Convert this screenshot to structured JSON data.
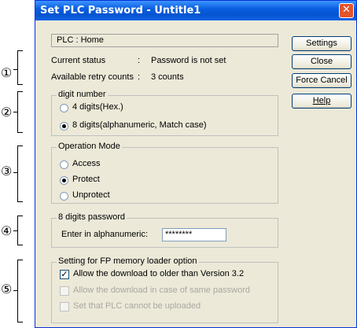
{
  "window": {
    "title": "Set PLC Password - Untitle1",
    "close_glyph": "✕"
  },
  "plc_bar": "PLC  :  Home",
  "status": {
    "current_label": "Current status",
    "current_sep": ":",
    "current_value": "Password is not set",
    "retry_label": "Available retry counts",
    "retry_sep": ":",
    "retry_value": "3 counts"
  },
  "buttons": {
    "settings": "Settings",
    "close": "Close",
    "force_cancel": "Force Cancel",
    "help": "Help"
  },
  "digit_group": {
    "title": "digit number",
    "opt1": "4 digits(Hex.)",
    "opt2": "8 digits(alphanumeric, Match case)",
    "selected": 2
  },
  "mode_group": {
    "title": "Operation Mode",
    "opt1": "Access",
    "opt2": "Protect",
    "opt3": "Unprotect",
    "selected": 2
  },
  "password_group": {
    "title": "8 digits password",
    "label": "Enter in alphanumeric:",
    "value": "********"
  },
  "loader_group": {
    "title": "Setting for FP memory loader option",
    "opt1": "Allow the download to older than Version 3.2",
    "opt2": "Allow the download in case of same password",
    "opt3": "Set that PLC cannot be uploaded",
    "check_glyph": "✓"
  },
  "callouts": [
    "①",
    "②",
    "③",
    "④",
    "⑤"
  ]
}
